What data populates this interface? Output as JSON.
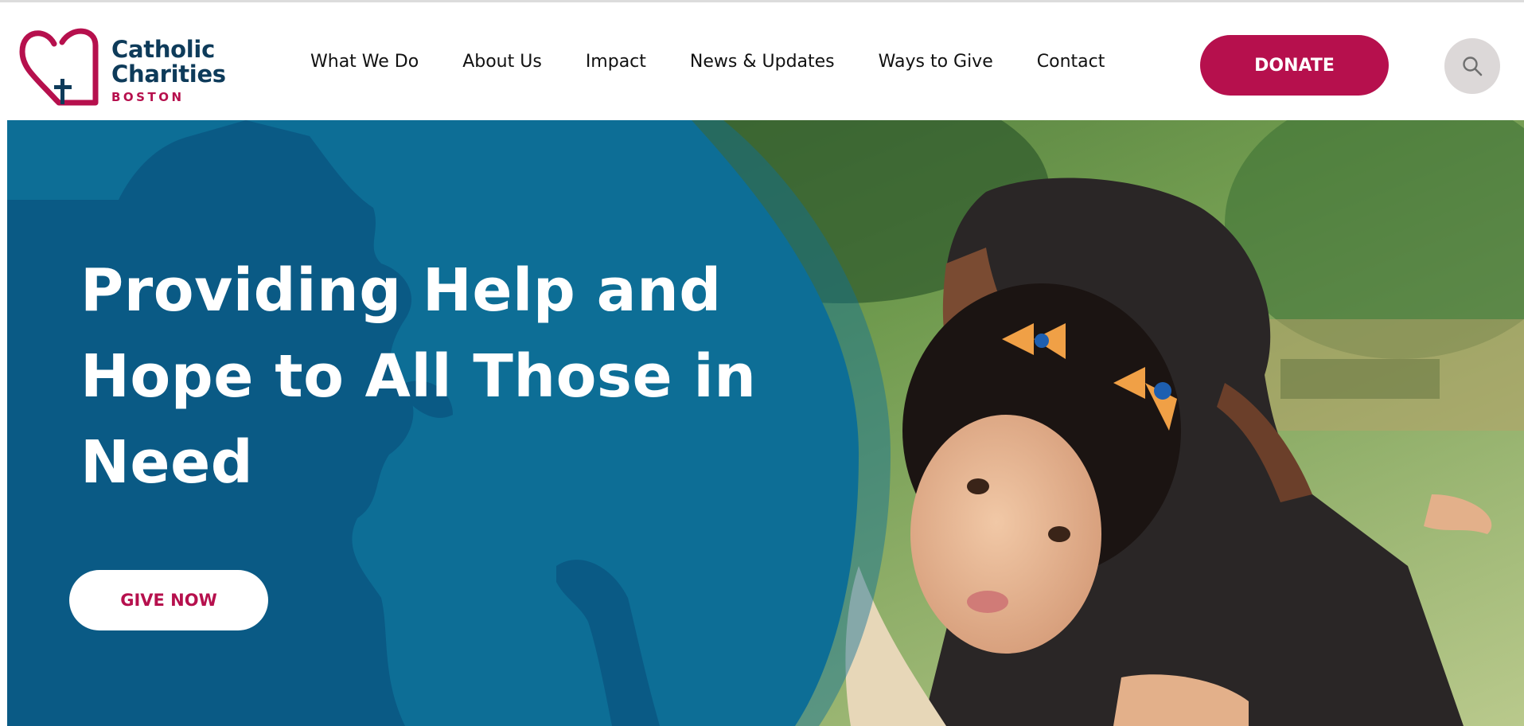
{
  "header": {
    "logo": {
      "line1": "Catholic",
      "line2": "Charities",
      "city": "BOSTON"
    },
    "nav": [
      {
        "label": "What We Do"
      },
      {
        "label": "About Us"
      },
      {
        "label": "Impact"
      },
      {
        "label": "News & Updates"
      },
      {
        "label": "Ways to Give"
      },
      {
        "label": "Contact"
      }
    ],
    "donate_label": "DONATE",
    "search_icon": "search-icon"
  },
  "hero": {
    "title": "Providing Help and Hope to All Those in Need",
    "cta_label": "GIVE NOW"
  },
  "colors": {
    "brand_navy": "#0e3b5a",
    "brand_magenta": "#b6104d",
    "hero_blue": "#0d6e96",
    "map_blue": "#0a5a85",
    "search_bg": "#dcd8d8"
  }
}
